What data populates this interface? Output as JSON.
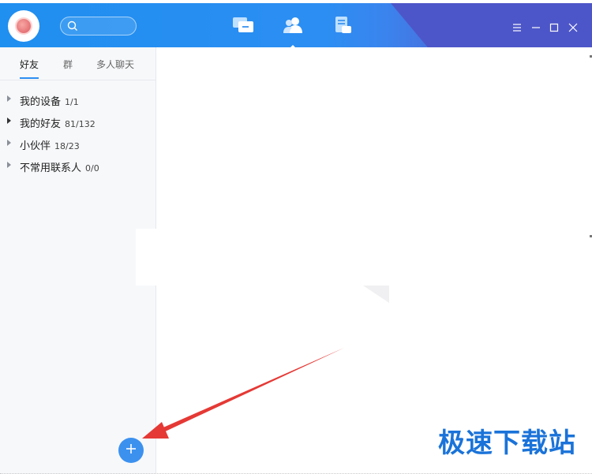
{
  "titlebar": {
    "search": {
      "placeholder": ""
    },
    "nav": [
      {
        "name": "messages-tab",
        "active": false
      },
      {
        "name": "contacts-tab",
        "active": true
      },
      {
        "name": "space-tab",
        "active": false
      }
    ],
    "controls": [
      "menu-icon",
      "minimize-icon",
      "maximize-icon",
      "close-icon"
    ]
  },
  "sidebar": {
    "tabs": [
      {
        "label": "好友",
        "active": true
      },
      {
        "label": "群",
        "active": false
      },
      {
        "label": "多人聊天",
        "active": false
      }
    ],
    "groups": [
      {
        "name": "我的设备",
        "count": "1/1",
        "expanded": false
      },
      {
        "name": "我的好友",
        "count": "81/132",
        "expanded": false
      },
      {
        "name": "小伙伴",
        "count": "18/23",
        "expanded": false
      },
      {
        "name": "不常用联系人",
        "count": "0/0",
        "expanded": false
      }
    ]
  },
  "watermark": {
    "text": "极速下载站"
  },
  "colors": {
    "accent": "#2c8ef2",
    "annotation_arrow": "#e53935",
    "watermark": "#1a73d9"
  }
}
